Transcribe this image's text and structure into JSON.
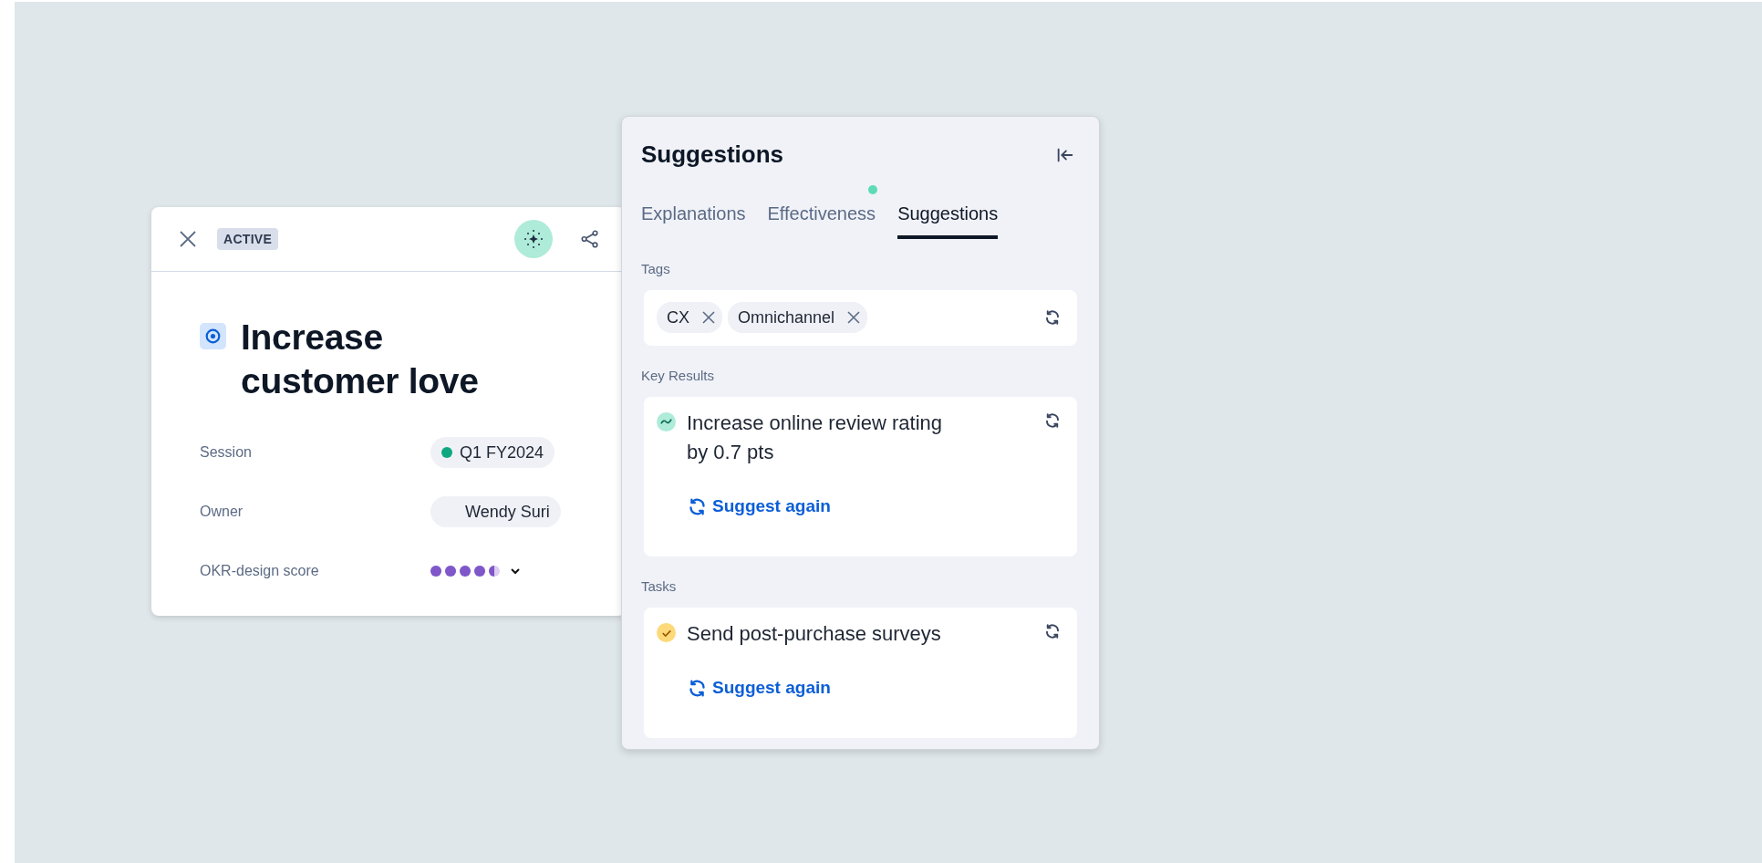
{
  "objective": {
    "status": "ACTIVE",
    "title": "Increase customer love",
    "fields": [
      {
        "kind": "chip",
        "label": "Session",
        "value": "Q1 FY2024",
        "dot": true
      },
      {
        "kind": "chip",
        "label": "Owner",
        "value": "Wendy Suri",
        "dot": false
      },
      {
        "kind": "score",
        "label": "OKR-design score",
        "stars": 4.5
      }
    ]
  },
  "panel": {
    "title": "Suggestions",
    "tabs": [
      {
        "label": "Explanations",
        "selected": false,
        "badge": false
      },
      {
        "label": "Effectiveness",
        "selected": false,
        "badge": true
      },
      {
        "label": "Suggestions",
        "selected": true,
        "badge": false
      }
    ],
    "sections": [
      {
        "kind": "tags",
        "heading": "Tags",
        "tags": [
          "CX",
          "Omnichannel"
        ]
      },
      {
        "kind": "key_result",
        "heading": "Key Results",
        "text": "Increase online review rating\nby 0.7 pts",
        "action": "Suggest again"
      },
      {
        "kind": "task",
        "heading": "Tasks",
        "text": "Send post-purchase surveys",
        "action": "Suggest again"
      }
    ]
  }
}
